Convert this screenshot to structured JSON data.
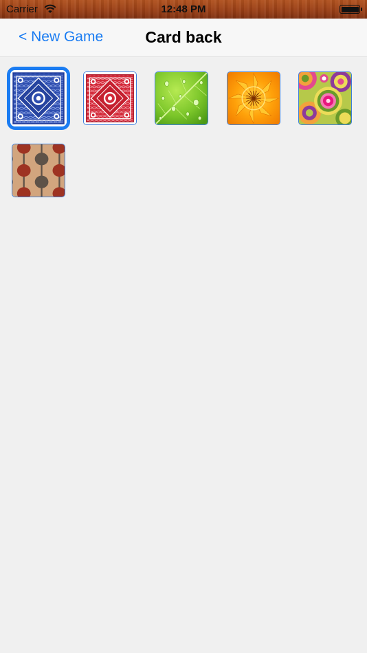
{
  "status_bar": {
    "carrier": "Carrier",
    "time": "12:48 PM"
  },
  "nav": {
    "back_label": "< New Game",
    "title": "Card back"
  },
  "colors": {
    "accent": "#1a7cf2",
    "card_border": "#3d7fdc",
    "background": "#f0f0f0"
  },
  "card_backs": [
    {
      "pattern": "blue-ornate",
      "selected": true
    },
    {
      "pattern": "red-ornate",
      "selected": false
    },
    {
      "pattern": "green-leaf-drops",
      "selected": false
    },
    {
      "pattern": "orange-kaleidoscope",
      "selected": false
    },
    {
      "pattern": "retro-circles",
      "selected": false
    },
    {
      "pattern": "retro-ovals",
      "selected": false
    }
  ]
}
